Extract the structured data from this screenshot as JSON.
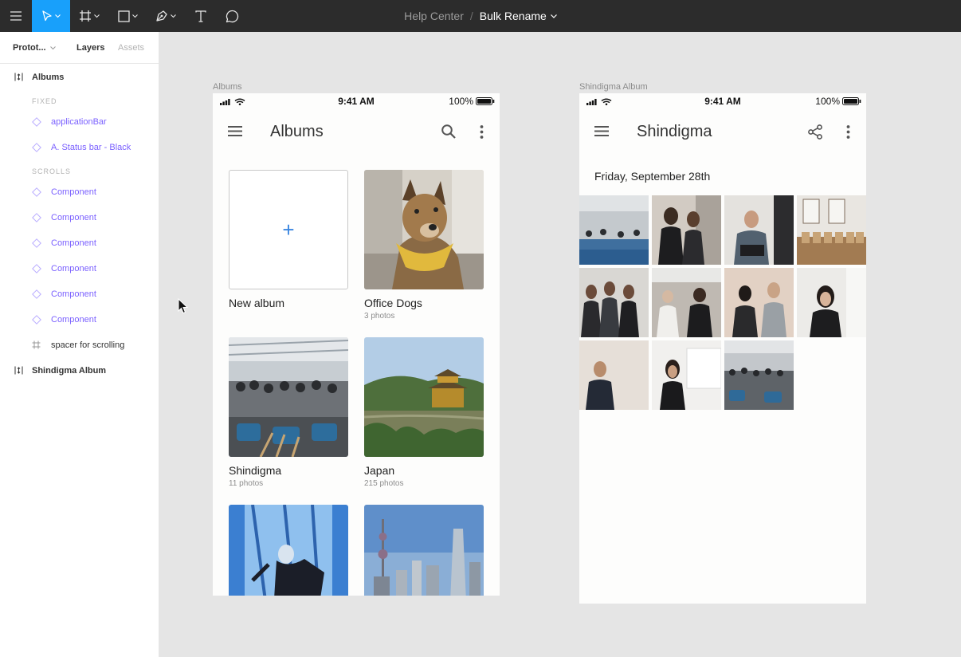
{
  "toolbar": {
    "breadcrumb_parent": "Help Center",
    "breadcrumb_separator": "/",
    "file_name": "Bulk Rename",
    "icons": [
      "menu-icon",
      "move-tool-icon",
      "frame-tool-icon",
      "rectangle-tool-icon",
      "pen-tool-icon",
      "text-tool-icon",
      "comment-icon"
    ],
    "accent": "#18a0fb"
  },
  "sidebar": {
    "page_tab": "Protot...",
    "layers_tab": "Layers",
    "assets_tab": "Assets",
    "frame_albums": "Albums",
    "section_fixed": "FIXED",
    "fixed_items": [
      "applicationBar",
      "A. Status bar - Black"
    ],
    "section_scrolls": "SCROLLS",
    "scroll_items": [
      "Component",
      "Component",
      "Component",
      "Component",
      "Component",
      "Component"
    ],
    "spacer_item": "spacer for scrolling",
    "frame_shindigma": "Shindigma Album",
    "component_color": "#7b61ff"
  },
  "albums_frame": {
    "label": "Albums",
    "status": {
      "time": "9:41 AM",
      "battery": "100%"
    },
    "title": "Albums",
    "new_album": {
      "plus": "+",
      "label": "New album"
    },
    "albums": [
      {
        "title": "Office Dogs",
        "count": "3 photos"
      },
      {
        "title": "Shindigma",
        "count": "11 photos"
      },
      {
        "title": "Japan",
        "count": "215 photos"
      }
    ]
  },
  "shindigma_frame": {
    "label": "Shindigma Album",
    "status": {
      "time": "9:41 AM",
      "battery": "100%"
    },
    "title": "Shindigma",
    "date": "Friday, September 28th"
  }
}
